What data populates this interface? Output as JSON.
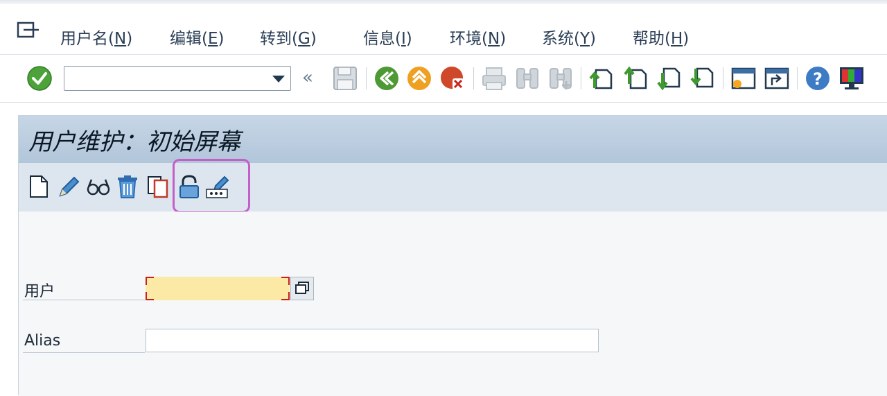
{
  "menubar": {
    "items": [
      {
        "text": "用户名(",
        "key": "N",
        "close": ")"
      },
      {
        "text": "编辑(",
        "key": "E",
        "close": ")"
      },
      {
        "text": "转到(",
        "key": "G",
        "close": ")"
      },
      {
        "text": "信息(",
        "key": "I",
        "close": ")"
      },
      {
        "text": "环境(",
        "key": "N",
        "close": ")"
      },
      {
        "text": "系统(",
        "key": "Y",
        "close": ")"
      },
      {
        "text": "帮助(",
        "key": "H",
        "close": ")"
      }
    ]
  },
  "toolbar": {
    "command_value": "",
    "back_chevron": "«",
    "icons": [
      "enter-icon",
      "save-icon",
      "back-icon",
      "exit-icon",
      "cancel-icon",
      "print-icon",
      "find-icon",
      "find-next-icon",
      "first-page-icon",
      "previous-page-icon",
      "next-page-icon",
      "last-page-icon",
      "create-session-icon",
      "shortcut-icon",
      "help-icon",
      "customize-layout-icon"
    ]
  },
  "screen": {
    "title": "用户维护：初始屏幕",
    "app_toolbar_icons": [
      "create-icon",
      "change-icon",
      "display-icon",
      "delete-icon",
      "copy-icon",
      "lock-unlock-icon",
      "change-password-icon"
    ],
    "highlight_color": "#c45ec8"
  },
  "form": {
    "user_label": "用户",
    "user_value": "",
    "alias_label": "Alias",
    "alias_value": ""
  },
  "colors": {
    "title_bar": "#b8cadc",
    "required_field": "#fde9a6",
    "required_marker": "#c8201a"
  }
}
